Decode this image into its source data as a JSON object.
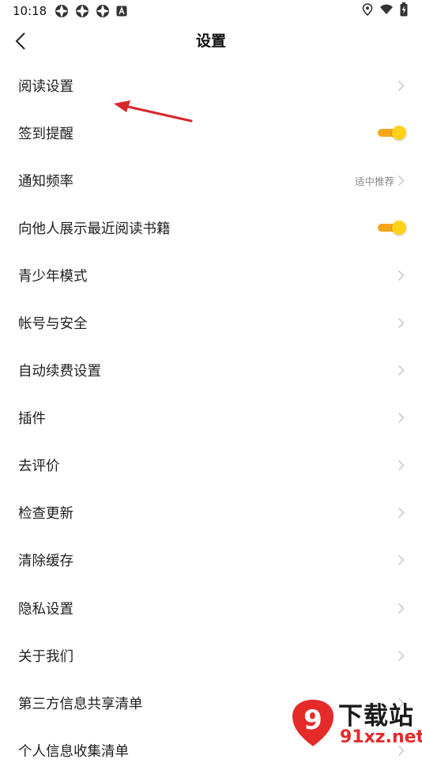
{
  "status_bar": {
    "time": "10:18",
    "notification_icons": [
      "app-notification-icon",
      "app-notification-icon",
      "app-notification-icon",
      "a-badge-icon"
    ],
    "system_icons": [
      "location-icon",
      "wifi-icon",
      "battery-charging-icon"
    ]
  },
  "header": {
    "title": "设置",
    "back_icon": "chevron-left-icon"
  },
  "settings": [
    {
      "label": "阅读设置",
      "control": "chevron"
    },
    {
      "label": "签到提醒",
      "control": "toggle",
      "on": true
    },
    {
      "label": "通知频率",
      "control": "chevron",
      "value": "适中推荐"
    },
    {
      "label": "向他人展示最近阅读书籍",
      "control": "toggle",
      "on": true
    },
    {
      "label": "青少年模式",
      "control": "chevron"
    },
    {
      "label": "帐号与安全",
      "control": "chevron"
    },
    {
      "label": "自动续费设置",
      "control": "chevron"
    },
    {
      "label": "插件",
      "control": "chevron"
    },
    {
      "label": "去评价",
      "control": "chevron"
    },
    {
      "label": "检查更新",
      "control": "chevron"
    },
    {
      "label": "清除缓存",
      "control": "chevron"
    },
    {
      "label": "隐私设置",
      "control": "chevron"
    },
    {
      "label": "关于我们",
      "control": "chevron"
    },
    {
      "label": "第三方信息共享清单",
      "control": "chevron"
    },
    {
      "label": "个人信息收集清单",
      "control": "chevron"
    }
  ],
  "colors": {
    "toggle_track": "#f7a51b",
    "toggle_thumb": "#ffd21a",
    "annotation_arrow": "#d9262b",
    "chevron": "#c4c4c4"
  },
  "watermark": {
    "logo_text": "9",
    "text_top": "下载站",
    "text_bottom": "91xz.net"
  }
}
